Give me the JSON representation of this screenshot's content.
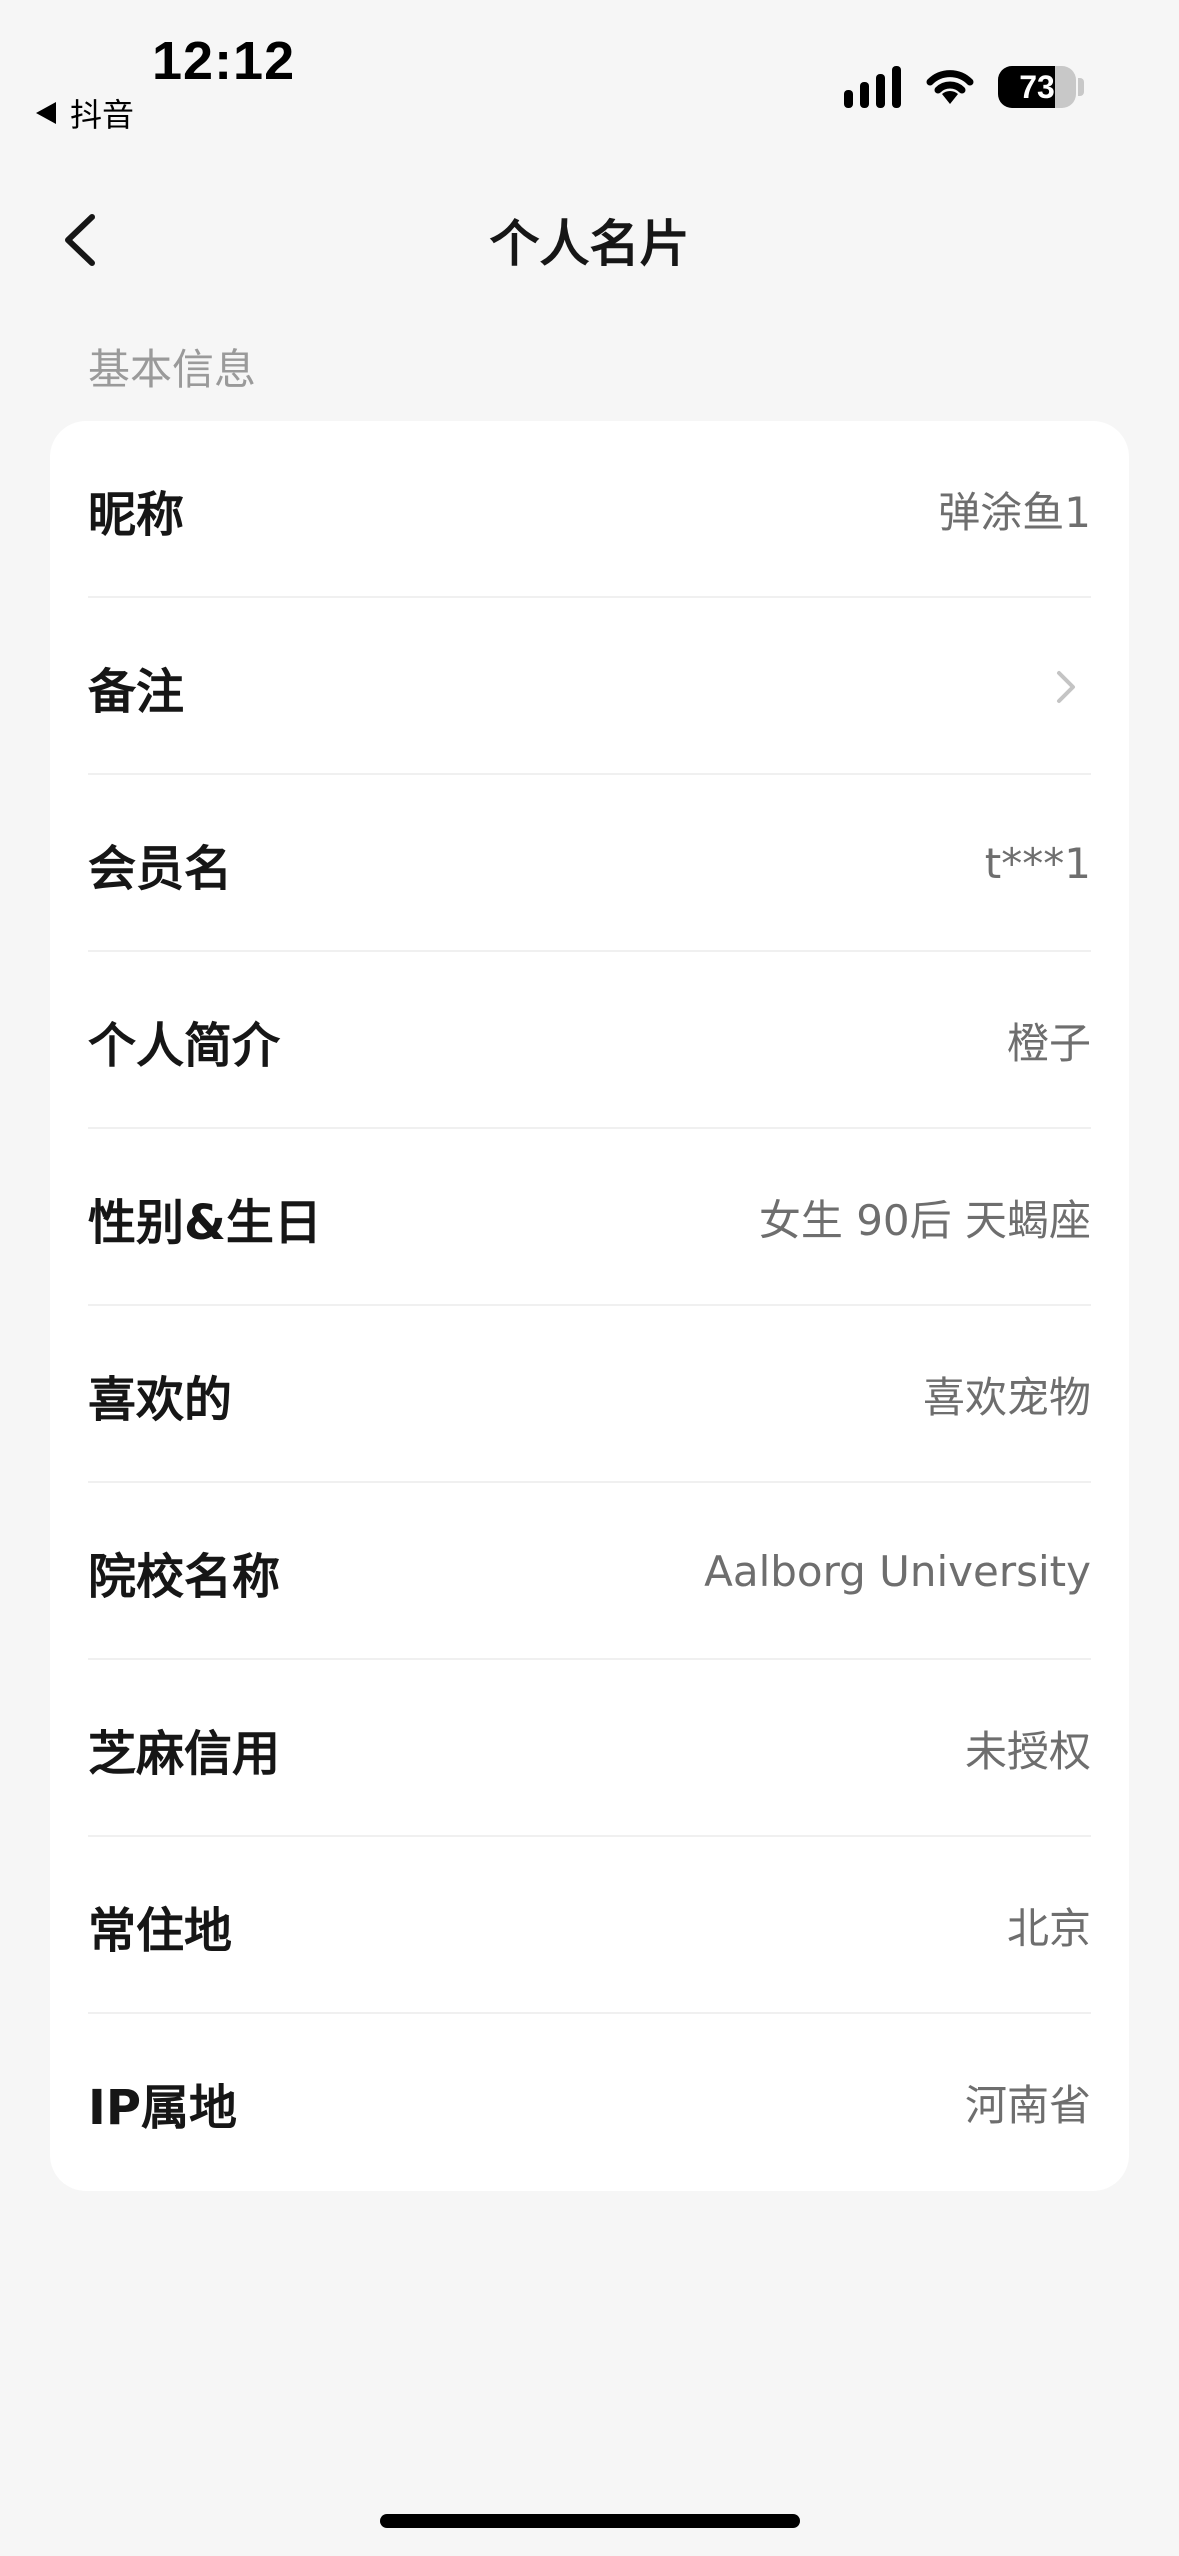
{
  "status_bar": {
    "time": "12:12",
    "back_app_label": "抖音",
    "battery_percent": "73",
    "battery_level": 0.73,
    "signal_icon": "cellular-signal-icon",
    "wifi_icon": "wifi-icon"
  },
  "nav": {
    "title": "个人名片",
    "back_icon": "chevron-left-icon"
  },
  "section": {
    "header": "基本信息"
  },
  "rows": [
    {
      "label": "昵称",
      "value": "弹涂鱼1"
    },
    {
      "label": "备注",
      "value": "",
      "icon": "chevron-right-icon"
    },
    {
      "label": "会员名",
      "value": "t***1"
    },
    {
      "label": "个人简介",
      "value": "橙子"
    },
    {
      "label": "性别&生日",
      "value": "女生 90后 天蝎座"
    },
    {
      "label": "喜欢的",
      "value": "喜欢宠物"
    },
    {
      "label": "院校名称",
      "value": "Aalborg University"
    },
    {
      "label": "芝麻信用",
      "value": "未授权"
    },
    {
      "label": "常住地",
      "value": "北京"
    },
    {
      "label": "IP属地",
      "value": "河南省"
    }
  ],
  "colors": {
    "background": "#f6f6f6",
    "card": "#ffffff",
    "label": "#161616",
    "value": "#6e6e6e",
    "section_header": "#9a9a9a",
    "divider": "#f0f0f0"
  }
}
